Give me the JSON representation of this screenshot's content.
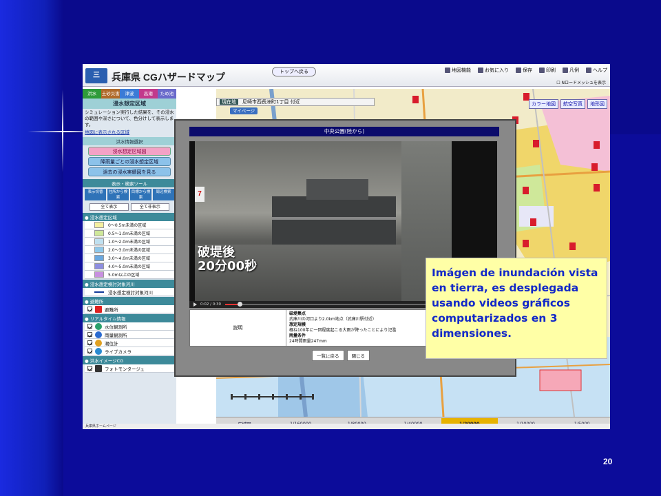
{
  "slide": {
    "page_number": "20"
  },
  "app": {
    "title": "CGハザードマップ",
    "prefecture": "兵庫県",
    "logo_text": "三",
    "top_button": "トップへ戻る",
    "menu": [
      "地図機能",
      "お気に入り",
      "保存",
      "印刷",
      "凡例",
      "ヘルプ"
    ],
    "mesh_checkbox": "Nロードメッシュを表示"
  },
  "sidebar": {
    "tabs": [
      {
        "label": "洪水",
        "color": "#2e9b3a"
      },
      {
        "label": "土砂災害",
        "color": "#b06a2a"
      },
      {
        "label": "津波",
        "color": "#3b7bd6"
      },
      {
        "label": "高潮",
        "color": "#c23a8c"
      },
      {
        "label": "ため池",
        "color": "#6a6acb"
      }
    ],
    "section_title": "浸水想定区域",
    "description": "シミュレーション実行した結果を、その浸水の範囲や深さについて、色分けして表示します。",
    "description_link": "地図に表示される区域",
    "info_select": "洪水情報選択",
    "pills": [
      "浸水想定区域図",
      "降雨量ごとの浸水想定区域",
      "過去の浸水実績図を見る"
    ],
    "tool_header": "表示・検索ツール",
    "tools": [
      "表示切替",
      "住所から検索",
      "目標から検索",
      "周辺検索"
    ],
    "show_all": "全て表示",
    "hide_all": "全て非表示",
    "legend_header": "浸水想定区域",
    "legend": [
      {
        "label": "0〜0.5m未満の区域",
        "color": "#f5f0a0"
      },
      {
        "label": "0.5〜1.0m未満の区域",
        "color": "#cfe89a"
      },
      {
        "label": "1.0〜2.0m未満の区域",
        "color": "#bfe0f0"
      },
      {
        "label": "2.0〜3.0m未満の区域",
        "color": "#8fc8ea"
      },
      {
        "label": "3.0〜4.0m未満の区域",
        "color": "#6aa8e0"
      },
      {
        "label": "4.0〜5.0m未満の区域",
        "color": "#8e8ee0"
      },
      {
        "label": "5.0m以上の区域",
        "color": "#c890e0"
      }
    ],
    "river_header": "浸水想定検討対象河川",
    "river_item": "浸水想定検討対象河川",
    "shelter_header": "避難所",
    "shelter_item": "避難所",
    "realtime_header": "リアルタイム情報",
    "realtime_items": [
      "水位観測所",
      "雨量観測所",
      "潮位計",
      "ライブカメラ"
    ],
    "cg_header": "洪水イメージCG",
    "cg_items": [
      "フォトモンタージュ"
    ]
  },
  "map": {
    "address_label": "現在地",
    "address": "尼崎市西長洲町1丁目 付近",
    "mypage": "マイページ",
    "map_types": [
      "カラー地図",
      "航空写真",
      "地形図"
    ],
    "scales": [
      "広域図",
      "1/160000",
      "1/80000",
      "1/40000",
      "1/20000",
      "1/10000",
      "1/5000"
    ],
    "active_scale": "1/20000",
    "footer": "兵庫県ホームページ"
  },
  "popup": {
    "title": "中央公園(陸から)",
    "caption_line1": "破堤後",
    "caption_line2": "20分00秒",
    "video_logo": "7",
    "time": "0:02 / 0:30",
    "progress": 0.07,
    "info_label": "説明",
    "info_lines": [
      {
        "bold": "破堤集点",
        "text": "武庫川の河口より2.0km地点（武庫川駅付近）"
      },
      {
        "bold": "想定規模",
        "text": "概ね100年に一回程度起こる大雨が降ったことにより氾濫"
      },
      {
        "bold": "雨量条件",
        "text": "24時間雨量247mm"
      }
    ],
    "buttons": [
      "一覧に戻る",
      "閉じる"
    ]
  },
  "callout": {
    "text": "Imágen de inundación vista en tierra, es desplegada usando videos gráficos computarizados en 3 dimensiones."
  }
}
